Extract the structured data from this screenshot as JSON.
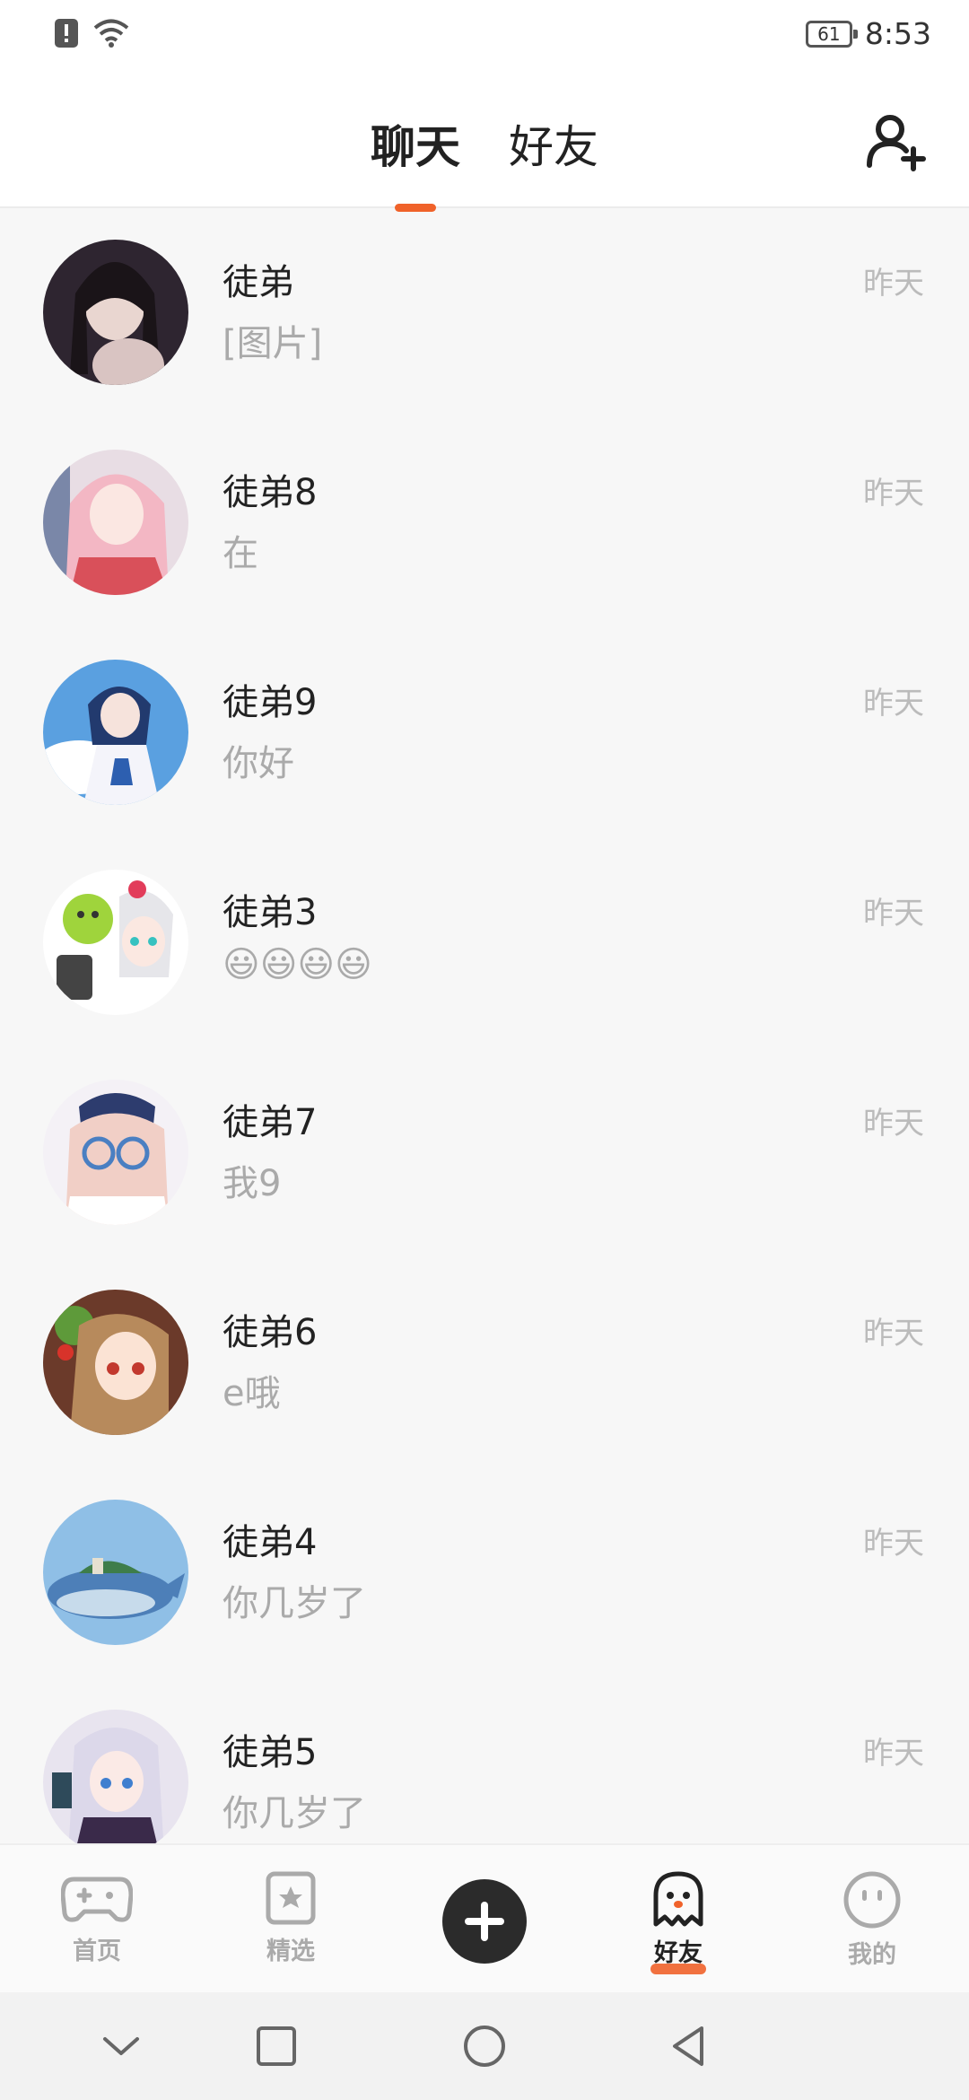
{
  "status_bar": {
    "battery": "61",
    "time": "8:53"
  },
  "header": {
    "tabs": [
      {
        "label": "聊天",
        "active": true
      },
      {
        "label": "好友",
        "active": false
      }
    ],
    "add_friend_icon": "add-user-icon"
  },
  "chats": [
    {
      "name": "徒弟",
      "message": "[图片]",
      "time": "昨天"
    },
    {
      "name": "徒弟8",
      "message": "在",
      "time": "昨天"
    },
    {
      "name": "徒弟9",
      "message": "你好",
      "time": "昨天"
    },
    {
      "name": "徒弟3",
      "message": "😃😃😃😃",
      "time": "昨天"
    },
    {
      "name": "徒弟7",
      "message": "我9",
      "time": "昨天"
    },
    {
      "name": "徒弟6",
      "message": "e哦",
      "time": "昨天"
    },
    {
      "name": "徒弟4",
      "message": "你几岁了",
      "time": "昨天"
    },
    {
      "name": "徒弟5",
      "message": "你几岁了",
      "time": "昨天"
    }
  ],
  "bottom_nav": {
    "items": [
      {
        "label": "首页",
        "icon": "gamepad-icon",
        "active": false
      },
      {
        "label": "精选",
        "icon": "star-bookmark-icon",
        "active": false
      },
      {
        "label": "好友",
        "icon": "ghost-icon",
        "active": true
      },
      {
        "label": "我的",
        "icon": "face-icon",
        "active": false
      }
    ],
    "center_button_icon": "plus-icon"
  },
  "colors": {
    "accent": "#f0622a",
    "text_primary": "#222222",
    "text_secondary": "#aaaaaa"
  }
}
